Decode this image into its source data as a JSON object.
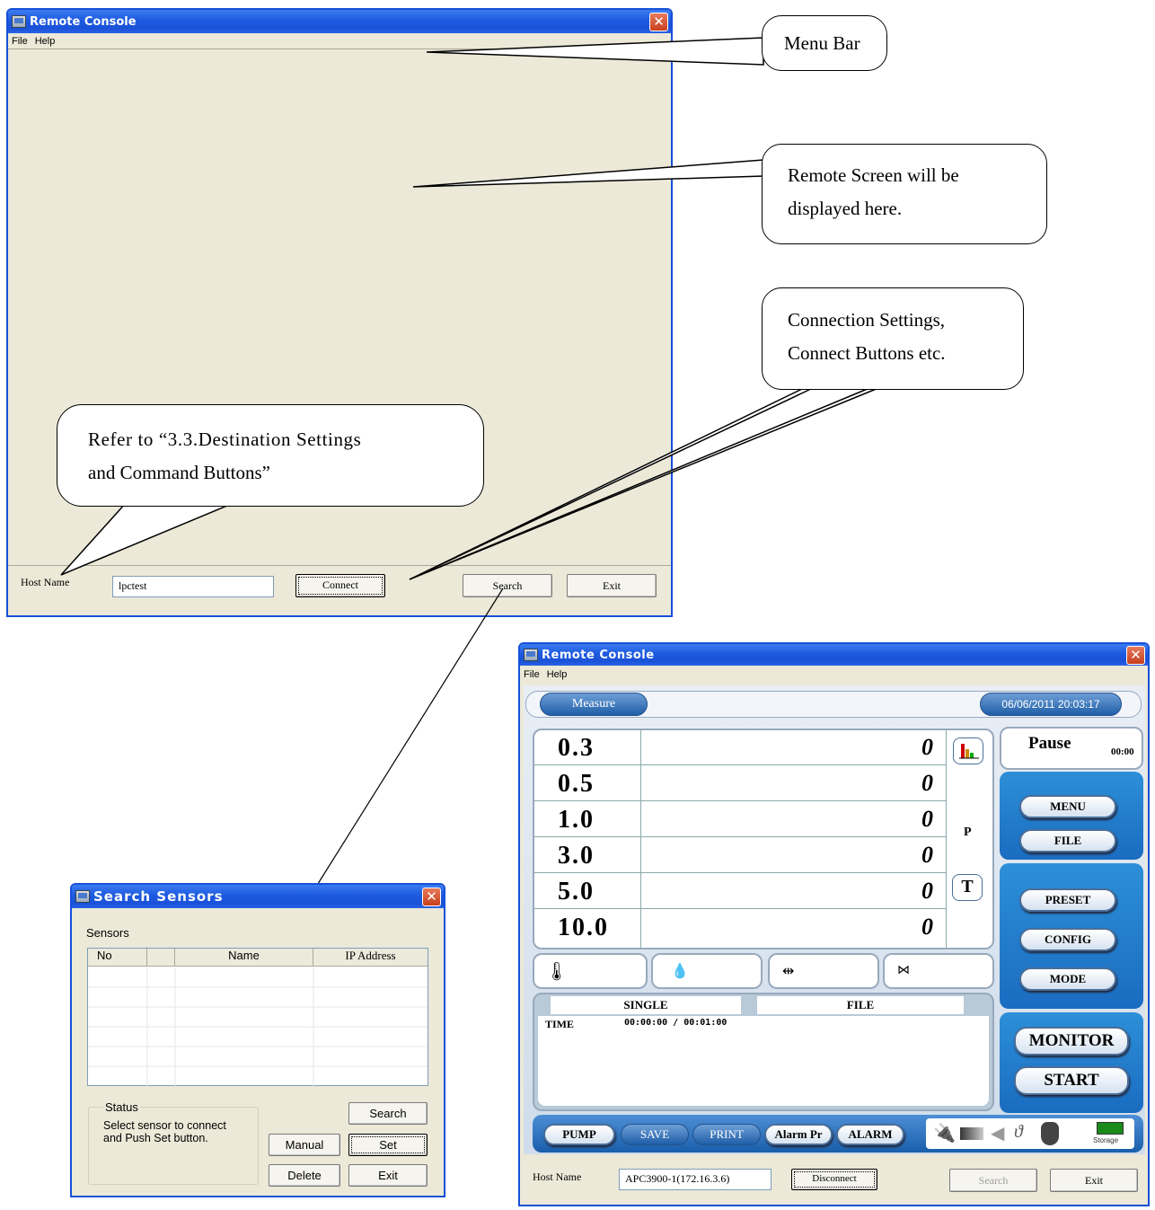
{
  "main_window": {
    "title": "Remote Console",
    "menu": [
      "File",
      "Help"
    ],
    "host_label": "Host Name",
    "host_value": "lpctest",
    "connect_label": "Connect",
    "search_label": "Search",
    "exit_label": "Exit"
  },
  "callouts": {
    "menu_bar": "Menu Bar",
    "remote_screen_1": "Remote Screen will be",
    "remote_screen_2": "displayed here.",
    "connection_1": "Connection Settings,",
    "connection_2": "Connect Buttons etc.",
    "refer_1": "Refer to “3.3.Destination Settings",
    "refer_2": "and Command Buttons”"
  },
  "search_window": {
    "title": "Search Sensors",
    "sensors_label": "Sensors",
    "columns": [
      "No",
      "",
      "Name",
      "IP Address"
    ],
    "status_label": "Status",
    "status_text": "Select sensor to connect and Push Set button.",
    "search_label": "Search",
    "manual_label": "Manual",
    "set_label": "Set",
    "delete_label": "Delete",
    "exit_label": "Exit"
  },
  "remote_window": {
    "title": "Remote Console",
    "menu": [
      "File",
      "Help"
    ],
    "mode_tab": "Measure",
    "datetime": "06/06/2011 20:03:17",
    "sizes": [
      {
        "size": "0.3",
        "count": "0"
      },
      {
        "size": "0.5",
        "count": "0"
      },
      {
        "size": "1.0",
        "count": "0"
      },
      {
        "size": "3.0",
        "count": "0"
      },
      {
        "size": "5.0",
        "count": "0"
      },
      {
        "size": "10.0",
        "count": "0"
      }
    ],
    "p_label": "P",
    "t_label": "T",
    "status": "Pause",
    "status_time": "00:00",
    "menu_btn": "MENU",
    "file_btn": "FILE",
    "preset_btn": "PRESET",
    "config_btn": "CONFIG",
    "mode_btn": "MODE",
    "monitor_btn": "MONITOR",
    "start_btn": "START",
    "single_label": "SINGLE",
    "file_label": "FILE",
    "time_label": "TIME",
    "time_value": "00:00:00 / 00:01:00",
    "bottom_buttons": [
      "PUMP",
      "SAVE",
      "PRINT",
      "Alarm Pr",
      "ALARM"
    ],
    "storage_label": "Storage",
    "host_label": "Host Name",
    "host_value": "APC3900-1(172.16.3.6)",
    "disconnect_label": "Disconnect",
    "search_label": "Search",
    "exit_label": "Exit"
  },
  "colors": {
    "xp_blue": "#1d5ae0",
    "window_bg": "#ece9d8",
    "app_blue": "#2f6fb8"
  }
}
